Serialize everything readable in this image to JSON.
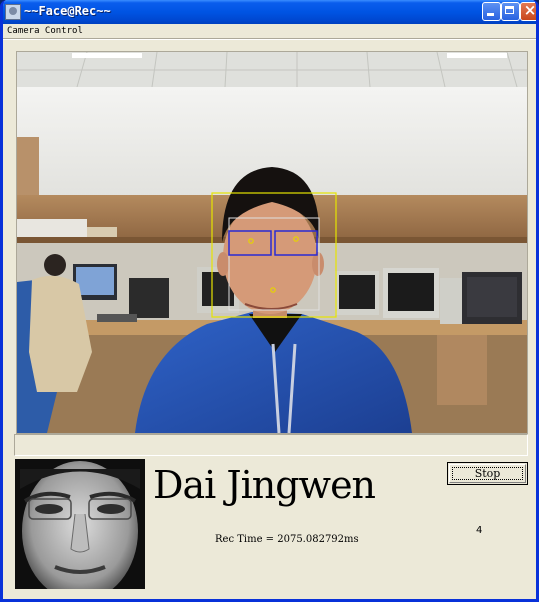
{
  "window": {
    "title": "~~Face@Rec~~",
    "title_bar_color": "#0054e3",
    "close_button_color": "#c8461c",
    "background": "#ece9d8"
  },
  "menu": {
    "items": [
      {
        "label": "Camera Control"
      }
    ]
  },
  "video_view": {
    "detection_box_color": "#e6e400",
    "eye_box_color": "#2a2ad4",
    "landmark_point_color": "#e6d400"
  },
  "result": {
    "name": "Dai Jingwen",
    "rec_time_text": "Rec Time = 2075.082792ms",
    "count": "4"
  },
  "buttons": {
    "stop_label": "Stop"
  },
  "icons": {
    "app": "app-icon",
    "minimize": "minimize-icon",
    "maximize": "maximize-icon",
    "close": "close-icon"
  }
}
